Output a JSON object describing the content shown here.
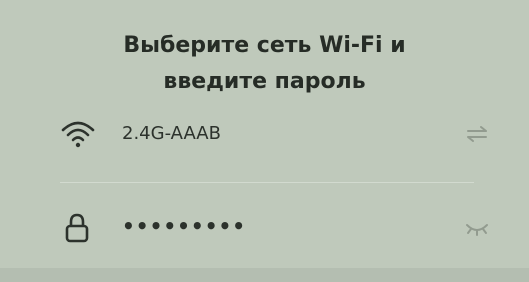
{
  "dialog": {
    "title_line1": "Выберите сеть Wi-Fi и",
    "title_line2": "введите пароль"
  },
  "network": {
    "ssid": "2.4G-AAAB",
    "lead_icon": "wifi-icon",
    "trail_icon": "switch-network-icon"
  },
  "password": {
    "masked_value": "•••••••••",
    "lead_icon": "lock-icon",
    "trail_icon": "eye-closed-icon"
  },
  "colors": {
    "background": "#bfc9bb",
    "text": "#2a302a",
    "divider": "#d2dacf"
  }
}
